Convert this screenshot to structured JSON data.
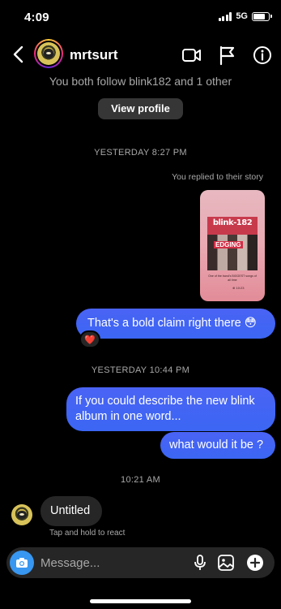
{
  "status_bar": {
    "time": "4:09",
    "network": "5G",
    "battery_level": 0.8
  },
  "header": {
    "username": "mrtsurt"
  },
  "intro": {
    "follow_text": "You both follow blink182 and 1 other",
    "view_profile_label": "View profile"
  },
  "timestamps": {
    "first": "YESTERDAY 8:27 PM",
    "second": "YESTERDAY 10:44 PM",
    "third": "10:21 AM"
  },
  "story_reply": {
    "label": "You replied to their story",
    "card_title": "blink-182",
    "card_badge": "EDGING",
    "card_caption": "One of the band's BIGGEST songs of all time",
    "card_meta": "⊕ 10:23"
  },
  "messages": [
    {
      "from": "me",
      "text": "That's a bold claim right there 😳"
    },
    {
      "from": "me",
      "text": "If you could describe the new blink album in one word..."
    },
    {
      "from": "me",
      "text": "what would it be ?"
    },
    {
      "from": "them",
      "text": "Untitled"
    }
  ],
  "reaction": {
    "emoji": "❤️"
  },
  "hint_text": "Tap and hold to react",
  "composer": {
    "placeholder": "Message..."
  },
  "colors": {
    "outgoing_bubble": "#3e63f4",
    "incoming_bubble": "#262626",
    "camera_button": "#3897f0"
  }
}
